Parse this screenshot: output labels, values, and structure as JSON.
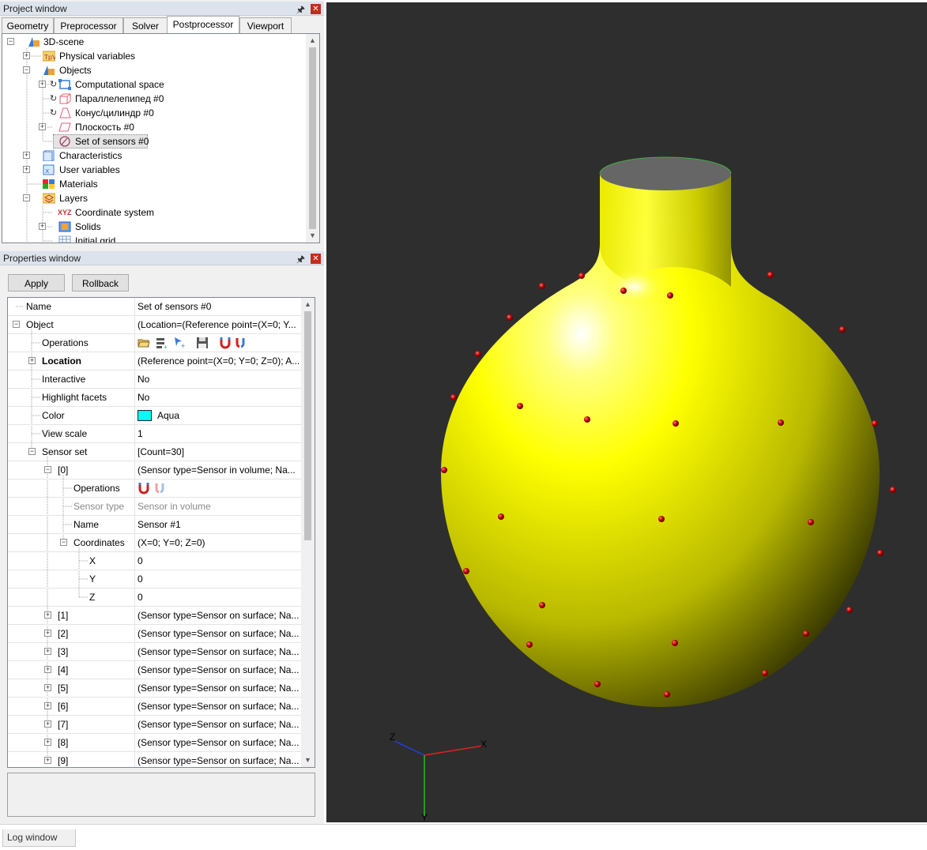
{
  "project_window": {
    "title": "Project window",
    "tabs": [
      {
        "label": "Geometry"
      },
      {
        "label": "Preprocessor"
      },
      {
        "label": "Solver"
      },
      {
        "label": "Postprocessor",
        "active": true
      },
      {
        "label": "Viewport"
      }
    ],
    "tree": [
      {
        "label": "3D-scene",
        "icon": "scene-icon",
        "expanded": true
      },
      {
        "label": "Physical variables",
        "icon": "physical-variables-icon"
      },
      {
        "label": "Objects",
        "icon": "objects-icon",
        "expanded": true
      },
      {
        "label": "Computational space",
        "icon": "computational-space-icon"
      },
      {
        "label": "Параллелепипед #0",
        "icon": "box-icon"
      },
      {
        "label": "Конус/цилиндр #0",
        "icon": "cone-icon"
      },
      {
        "label": "Плоскость #0",
        "icon": "plane-icon"
      },
      {
        "label": "Set of sensors #0",
        "icon": "sensors-icon",
        "selected": true
      },
      {
        "label": "Characteristics",
        "icon": "characteristics-icon"
      },
      {
        "label": "User variables",
        "icon": "user-variables-icon"
      },
      {
        "label": "Materials",
        "icon": "materials-icon"
      },
      {
        "label": "Layers",
        "icon": "layers-icon",
        "expanded": true
      },
      {
        "label": "Coordinate system",
        "icon": "xyz-icon",
        "icon_text": "XYZ"
      },
      {
        "label": "Solids",
        "icon": "solids-icon"
      },
      {
        "label": "Initial grid",
        "icon": "grid-icon"
      }
    ]
  },
  "properties_window": {
    "title": "Properties window",
    "apply_label": "Apply",
    "rollback_label": "Rollback",
    "rows": [
      {
        "name": "Name",
        "value": "Set of sensors #0"
      },
      {
        "name": "Object",
        "value": "(Location=(Reference point=(X=0; Y..."
      },
      {
        "name": "Operations",
        "value": ""
      },
      {
        "name": "Location",
        "value": "(Reference point=(X=0; Y=0; Z=0); A..."
      },
      {
        "name": "Interactive",
        "value": "No"
      },
      {
        "name": "Highlight facets",
        "value": "No"
      },
      {
        "name": "Color",
        "value": "Aqua",
        "color": "#00ffff"
      },
      {
        "name": "View scale",
        "value": "1"
      },
      {
        "name": "Sensor set",
        "value": "[Count=30]"
      },
      {
        "name": "[0]",
        "value": "(Sensor type=Sensor in volume; Na..."
      },
      {
        "name": "Operations",
        "value": ""
      },
      {
        "name": "Sensor type",
        "value": "Sensor in volume"
      },
      {
        "name": "Name",
        "value": "Sensor #1"
      },
      {
        "name": "Coordinates",
        "value": "(X=0; Y=0; Z=0)"
      },
      {
        "name": "X",
        "value": "0"
      },
      {
        "name": "Y",
        "value": "0"
      },
      {
        "name": "Z",
        "value": "0"
      },
      {
        "name": "[1]",
        "value": "(Sensor type=Sensor on surface; Na..."
      },
      {
        "name": "[2]",
        "value": "(Sensor type=Sensor on surface; Na..."
      },
      {
        "name": "[3]",
        "value": "(Sensor type=Sensor on surface; Na..."
      },
      {
        "name": "[4]",
        "value": "(Sensor type=Sensor on surface; Na..."
      },
      {
        "name": "[5]",
        "value": "(Sensor type=Sensor on surface; Na..."
      },
      {
        "name": "[6]",
        "value": "(Sensor type=Sensor on surface; Na..."
      },
      {
        "name": "[7]",
        "value": "(Sensor type=Sensor on surface; Na..."
      },
      {
        "name": "[8]",
        "value": "(Sensor type=Sensor on surface; Na..."
      },
      {
        "name": "[9]",
        "value": "(Sensor type=Sensor on surface; Na..."
      }
    ]
  },
  "viewport": {
    "background": "#2e2e2e",
    "body_color": "#ffff00",
    "sensor_color": "#c00000",
    "axis_labels": {
      "x": "X",
      "y": "Y",
      "z": "Z"
    },
    "axis_colors": {
      "x": "#e02020",
      "y": "#20c020",
      "z": "#2020e0"
    }
  },
  "log_window": {
    "label": "Log window"
  }
}
